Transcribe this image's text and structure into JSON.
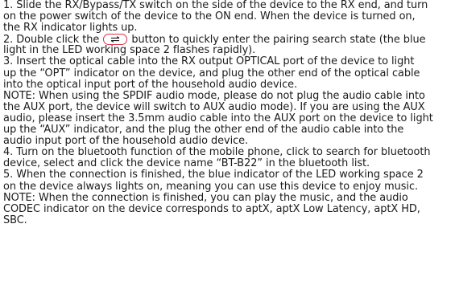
{
  "document": {
    "lines": [
      "1. Slide the RX/Bypass/TX switch on the side of the device to the RX end, and turn",
      "on the power switch of the device to the ON end. When the device is turned on,",
      "the RX indicator lights up.",
      "2. Double click the ",
      " button to quickly enter the pairing search state (the blue",
      "light in the LED working space 2 flashes rapidly).",
      "3. Insert the optical cable into the RX output OPTICAL port of the device to light",
      "up the “OPT” indicator on the device, and plug the other end of the optical cable",
      "into the optical input port of the household audio device.",
      "NOTE: When using the SPDIF audio mode, please do not plug the audio cable into",
      "the AUX port, the device will switch to AUX audio mode). If you are using the AUX",
      "audio, please insert the 3.5mm audio cable into the AUX port on the device to light",
      "up the “AUX” indicator, and the plug the other end of the audio cable into the",
      "audio input port of the household audio device.",
      "4. Turn on the bluetooth function of the mobile phone, click to search for bluetooth",
      "device, select and click the device name “BT-B22” in the bluetooth list.",
      "5. When the connection is finished, the blue indicator of the LED working space 2",
      "on the device always lights on, meaning you can use this device to enjoy music.",
      "NOTE: When the connection is finished, you can play the music, and the audio",
      "CODEC indicator on the device corresponds to aptX, aptX Low Latency, aptX HD,",
      "SBC."
    ],
    "inline_icon": "pairing-button-icon",
    "icon_color": "#d9334a"
  }
}
